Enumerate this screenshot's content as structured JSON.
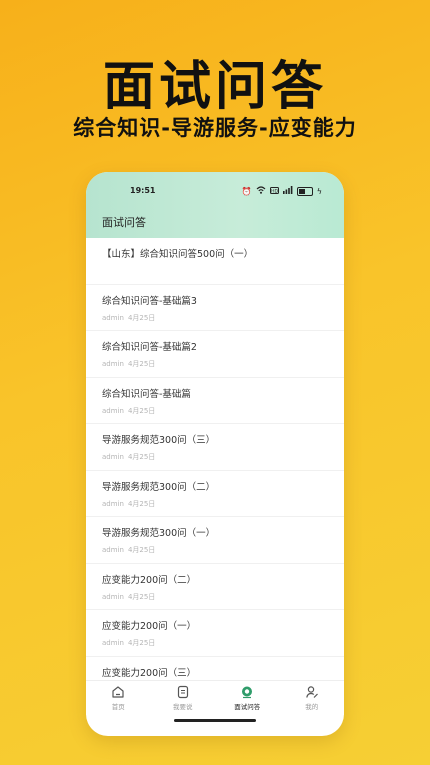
{
  "promo": {
    "title": "面试问答",
    "subtitle": "综合知识-导游服务-应变能力"
  },
  "status_bar": {
    "time": "19:51",
    "icons": [
      "alarm-icon",
      "wifi-icon",
      "hd-icon",
      "signal-icon",
      "battery-icon",
      "charging-icon"
    ]
  },
  "header": {
    "title": "面试问答"
  },
  "list": [
    {
      "title": "【山东】综合知识问答500问（一）",
      "author": "",
      "date": ""
    },
    {
      "title": "综合知识问答-基础篇3",
      "author": "admin",
      "date": "4月25日"
    },
    {
      "title": "综合知识问答-基础篇2",
      "author": "admin",
      "date": "4月25日"
    },
    {
      "title": "综合知识问答-基础篇",
      "author": "admin",
      "date": "4月25日"
    },
    {
      "title": "导游服务规范300问（三）",
      "author": "admin",
      "date": "4月25日"
    },
    {
      "title": "导游服务规范300问（二）",
      "author": "admin",
      "date": "4月25日"
    },
    {
      "title": "导游服务规范300问（一）",
      "author": "admin",
      "date": "4月25日"
    },
    {
      "title": "应变能力200问（二）",
      "author": "admin",
      "date": "4月25日"
    },
    {
      "title": "应变能力200问（一）",
      "author": "admin",
      "date": "4月25日"
    },
    {
      "title": "应变能力200问（三）",
      "author": "",
      "date": ""
    }
  ],
  "tabbar": [
    {
      "label": "首页",
      "icon": "home-icon",
      "active": false
    },
    {
      "label": "我要说",
      "icon": "chat-icon",
      "active": false
    },
    {
      "label": "面试问答",
      "icon": "qa-icon",
      "active": true
    },
    {
      "label": "我的",
      "icon": "profile-icon",
      "active": false
    }
  ],
  "colors": {
    "background": "#f9c42a",
    "header_gradient_start": "#b6e4cf",
    "active_tab": "#2f9c6a"
  }
}
